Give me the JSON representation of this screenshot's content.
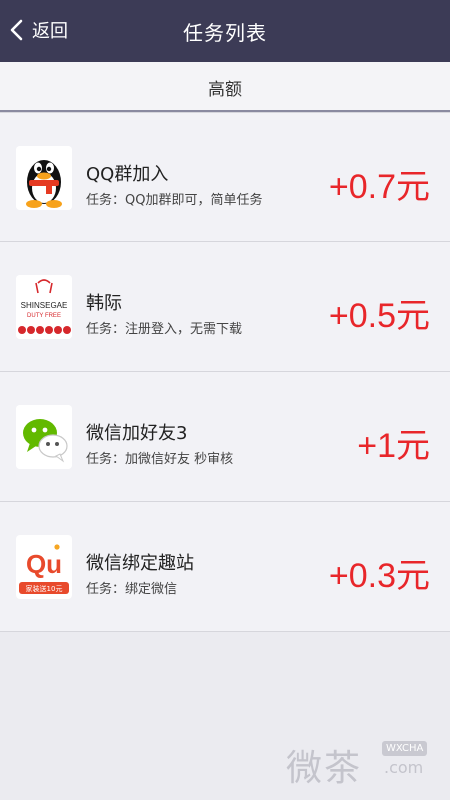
{
  "header": {
    "back_label": "返回",
    "title": "任务列表"
  },
  "tab": {
    "label": "高额"
  },
  "tasks": [
    {
      "name": "QQ群加入",
      "desc": "任务：QQ加群即可，简单任务",
      "reward": "+0.7元",
      "icon": "qq-penguin-icon"
    },
    {
      "name": "韩际",
      "desc": "任务：注册登入，无需下载",
      "reward": "+0.5元",
      "icon": "shinsegae-duty-free-icon"
    },
    {
      "name": "微信加好友3",
      "desc": "任务：加微信好友 秒审核",
      "reward": "+1元",
      "icon": "wechat-icon"
    },
    {
      "name": "微信绑定趣站",
      "desc": "任务：绑定微信",
      "reward": "+0.3元",
      "icon": "qu-app-icon"
    }
  ],
  "icon_text": {
    "shinsegae_top": "SHINSEGAE",
    "shinsegae_bottom": "DUTY FREE",
    "qu_logo": "Qu",
    "qu_badge": "家装送10元"
  },
  "watermark": {
    "cn": "微茶",
    "en": "WXCHA",
    "dotcom": ".com"
  },
  "colors": {
    "header_bg": "#3c3b56",
    "reward": "#e8262a",
    "page_bg": "#ebebf0"
  }
}
